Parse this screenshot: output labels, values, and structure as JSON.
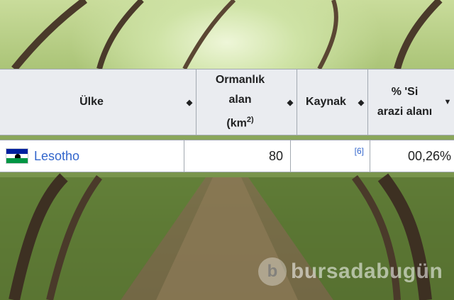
{
  "table": {
    "headers": [
      {
        "label_lines": [
          "Ülke"
        ],
        "sort_icon": "sort-both-icon"
      },
      {
        "label_lines": [
          "Ormanlık",
          "alan",
          "(km"
        ],
        "superscript": "2)",
        "sort_icon": "sort-both-icon"
      },
      {
        "label_lines": [
          "Kaynak"
        ],
        "sort_icon": "sort-both-icon"
      },
      {
        "label_lines": [
          "% 'Si",
          "arazi alanı"
        ],
        "sort_icon": "sort-down-icon"
      }
    ],
    "rows": [
      {
        "country": "Lesotho",
        "flag": "lesotho-flag",
        "forest_area": "80",
        "source": "[6]",
        "land_percent": "00,26%"
      }
    ]
  },
  "watermark": {
    "text": "bursadabugün",
    "logo_letter": "b"
  }
}
